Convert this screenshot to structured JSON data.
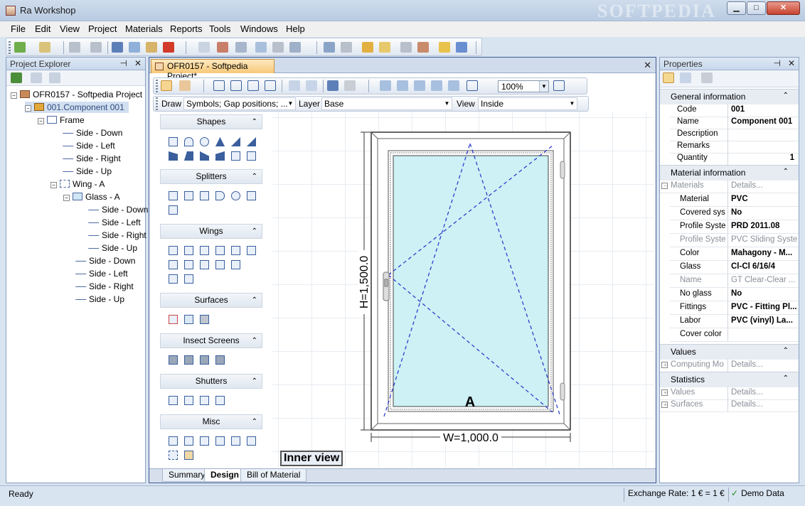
{
  "window": {
    "title": "Ra Workshop",
    "watermark": "SOFTPEDIA",
    "minimize": "▁",
    "maximize": "□",
    "close": "✕"
  },
  "menu": [
    "File",
    "Edit",
    "View",
    "Project",
    "Materials",
    "Reports",
    "Tools",
    "Windows",
    "Help"
  ],
  "project_explorer": {
    "title": "Project Explorer",
    "pin": "⊣",
    "close": "✕",
    "tree": [
      {
        "label": "OFR0157 - Softpedia Project",
        "icon": "project-icon"
      },
      {
        "label": "001.Component 001",
        "icon": "component-icon"
      },
      {
        "label": "Frame",
        "icon": "frame-icon"
      },
      {
        "label": "Side - Down",
        "icon": "side-icon"
      },
      {
        "label": "Side - Left",
        "icon": "side-icon"
      },
      {
        "label": "Side - Right",
        "icon": "side-icon"
      },
      {
        "label": "Side - Up",
        "icon": "side-icon"
      },
      {
        "label": "Wing - A",
        "icon": "wing-icon"
      },
      {
        "label": "Glass - A",
        "icon": "glass-icon"
      },
      {
        "label": "Side - Down",
        "icon": "side-icon"
      },
      {
        "label": "Side - Left",
        "icon": "side-icon"
      },
      {
        "label": "Side - Right",
        "icon": "side-icon"
      },
      {
        "label": "Side - Up",
        "icon": "side-icon"
      },
      {
        "label": "Side - Down",
        "icon": "side-icon"
      },
      {
        "label": "Side - Left",
        "icon": "side-icon"
      },
      {
        "label": "Side - Right",
        "icon": "side-icon"
      },
      {
        "label": "Side - Up",
        "icon": "side-icon"
      }
    ]
  },
  "document": {
    "tab_title": "OFR0157 - Softpedia Project*",
    "close": "✕",
    "zoom": "100%",
    "layer_bar": {
      "draw_label": "Draw",
      "draw_value": "Symbols; Gap positions; ...",
      "layer_label": "Layer",
      "layer_value": "Base",
      "view_label": "View",
      "view_value": "Inside"
    },
    "toolbox": {
      "groups": [
        "Shapes",
        "Splitters",
        "Wings",
        "Surfaces",
        "Insect Screens",
        "Shutters",
        "Misc"
      ]
    },
    "drawing": {
      "height_label": "H=1,500.0",
      "width_label": "W=1,000.0",
      "wing_label": "A",
      "view_label": "Inner view"
    },
    "bottom_tabs": [
      "Summary",
      "Design",
      "Bill of Material"
    ]
  },
  "properties": {
    "title": "Properties",
    "pin": "⊣",
    "close": "✕",
    "categories": {
      "general": "General information",
      "material": "Material information",
      "values": "Values",
      "statistics": "Statistics"
    },
    "general_rows": [
      {
        "name": "Code",
        "value": "001"
      },
      {
        "name": "Name",
        "value": "Component 001"
      },
      {
        "name": "Description",
        "value": ""
      },
      {
        "name": "Remarks",
        "value": ""
      },
      {
        "name": "Quantity",
        "value": "1"
      }
    ],
    "material_rows": [
      {
        "name": "Materials",
        "value": "Details..."
      },
      {
        "name": "Material",
        "value": "PVC"
      },
      {
        "name": "Covered sys",
        "value": "No"
      },
      {
        "name": "Profile Syste",
        "value": "PRD 2011.08"
      },
      {
        "name": "Profile Syste",
        "value": "PVC Sliding System"
      },
      {
        "name": "Color",
        "value": "Mahagony - M..."
      },
      {
        "name": "Glass",
        "value": "Cl-Cl 6/16/4"
      },
      {
        "name": "Name",
        "value": "GT Clear-Clear ..."
      },
      {
        "name": "No glass",
        "value": "No"
      },
      {
        "name": "Fittings",
        "value": "PVC - Fitting Pl..."
      },
      {
        "name": "Labor",
        "value": "PVC (vinyl) La..."
      },
      {
        "name": "Cover color",
        "value": ""
      }
    ],
    "values_rows": [
      {
        "name": "Computing Mo",
        "value": "Details..."
      }
    ],
    "statistics_rows": [
      {
        "name": "Values",
        "value": "Details..."
      },
      {
        "name": "Surfaces",
        "value": "Details..."
      }
    ]
  },
  "status": {
    "left": "Ready",
    "exchange": "Exchange Rate: 1 € = 1 €",
    "demo": "Demo Data"
  }
}
